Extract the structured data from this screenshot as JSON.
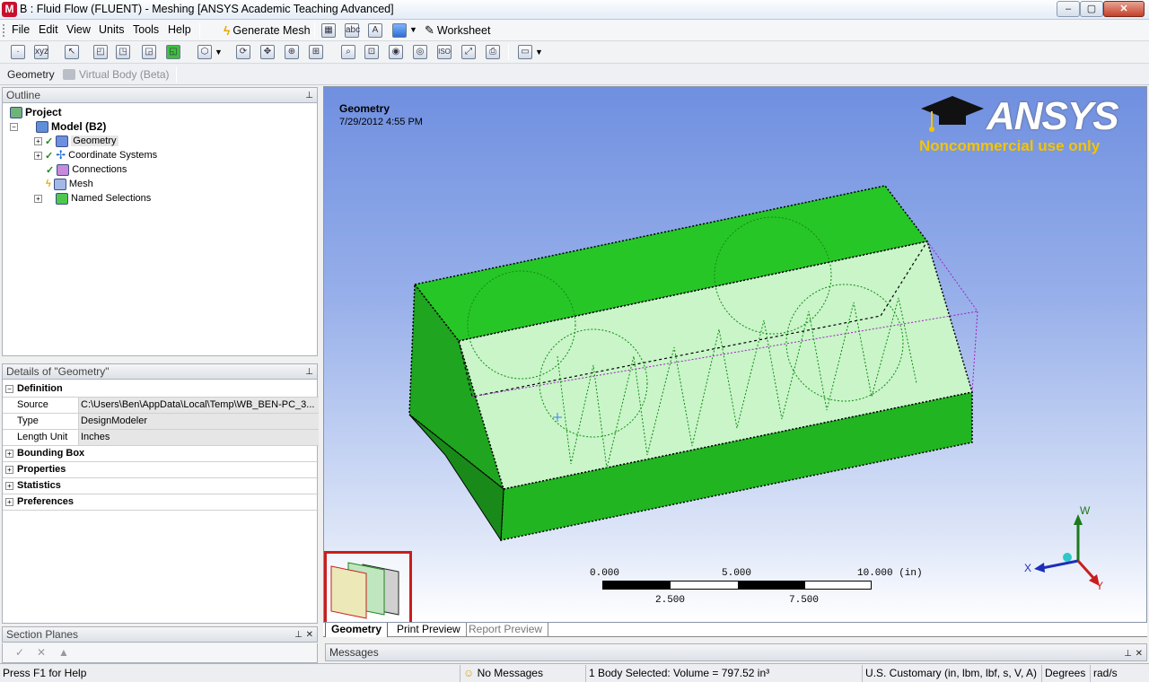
{
  "window": {
    "title": "B : Fluid Flow (FLUENT) - Meshing [ANSYS Academic Teaching Advanced]",
    "app_icon": "M",
    "min": "–",
    "max": "▢",
    "close": "✕"
  },
  "menu": {
    "items": [
      "File",
      "Edit",
      "View",
      "Units",
      "Tools",
      "Help"
    ],
    "generate_mesh": "Generate Mesh",
    "worksheet": "Worksheet"
  },
  "context": {
    "geometry": "Geometry",
    "virtual_body": "Virtual Body (Beta)"
  },
  "outline": {
    "header": "Outline",
    "pin": "📌",
    "tree": {
      "project": "Project",
      "model": "Model (B2)",
      "children": [
        "Geometry",
        "Coordinate Systems",
        "Connections",
        "Mesh",
        "Named Selections"
      ]
    }
  },
  "details": {
    "header": "Details of \"Geometry\"",
    "definition": "Definition",
    "rows": [
      {
        "label": "Source",
        "value": "C:\\Users\\Ben\\AppData\\Local\\Temp\\WB_BEN-PC_3..."
      },
      {
        "label": "Type",
        "value": "DesignModeler"
      },
      {
        "label": "Length Unit",
        "value": "Inches"
      }
    ],
    "groups": [
      "Bounding Box",
      "Properties",
      "Statistics",
      "Preferences"
    ]
  },
  "viewport": {
    "title": "Geometry",
    "date": "7/29/2012 4:55 PM",
    "logo": "ANSYS",
    "logo_note": "Noncommercial use only",
    "scale": {
      "top_labels": [
        "0.000",
        "5.000",
        "10.000 (in)"
      ],
      "bottom_labels": [
        "2.500",
        "7.500"
      ]
    },
    "triad": {
      "x": "X",
      "y": "Y",
      "z": "W"
    },
    "tabs": [
      "Geometry",
      "Print Preview",
      "Report Preview"
    ]
  },
  "section_planes": {
    "header": "Section Planes"
  },
  "messages": {
    "header": "Messages"
  },
  "status": {
    "help": "Press F1 for Help",
    "messages": "No Messages",
    "selection": "1 Body Selected: Volume = 797.52 in³",
    "units": "U.S. Customary (in, lbm, lbf, s, V, A)",
    "angle": "Degrees",
    "rate": "rad/s"
  },
  "colors": {
    "body_green": "#22cc22",
    "accent_red": "#c81e1e",
    "logo_yellow": "#f5c400"
  }
}
